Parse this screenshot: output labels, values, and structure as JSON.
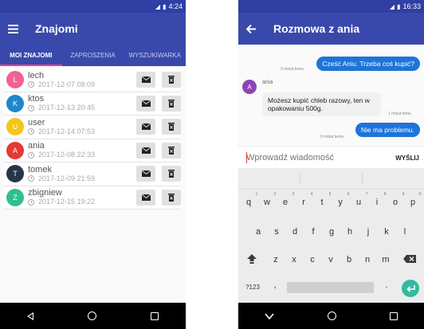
{
  "left": {
    "status": {
      "time": "4:24"
    },
    "appbar": {
      "title": "Znajomi"
    },
    "tabs": [
      {
        "label": "MOI ZNAJOMI",
        "active": true
      },
      {
        "label": "ZAPROSZENIA",
        "active": false
      },
      {
        "label": "WYSZUKIWARKA",
        "active": false
      }
    ],
    "friends": [
      {
        "initial": "L",
        "name": "lech",
        "date": "2017-12-07 08:09",
        "color": "#f06292"
      },
      {
        "initial": "K",
        "name": "ktos",
        "date": "2017-12-13 20:45",
        "color": "#1e88c8"
      },
      {
        "initial": "U",
        "name": "user",
        "date": "2017-12-14 07:53",
        "color": "#f5c518"
      },
      {
        "initial": "A",
        "name": "ania",
        "date": "2017-12-08 22:33",
        "color": "#e53935"
      },
      {
        "initial": "T",
        "name": "tomek",
        "date": "2017-12-09 21:59",
        "color": "#263548"
      },
      {
        "initial": "Z",
        "name": "zbigniew",
        "date": "2017-12-15 19:22",
        "color": "#2fbf8f"
      }
    ]
  },
  "right": {
    "status": {
      "time": "16:33"
    },
    "appbar": {
      "title": "Rozmowa z ania"
    },
    "messages": {
      "out1": {
        "text": "Cześć Aniu. Trzeba coś kupić?",
        "time": "3 minut temu"
      },
      "in1": {
        "sender_initial": "A",
        "sender_name": "ania",
        "text": "Możesz kupić chleb razowy, ten w opakowaniu 500g.",
        "time": "1 minut temu"
      },
      "out2": {
        "text": "Nie ma problemu.",
        "time": "0 minut temu"
      }
    },
    "composer": {
      "placeholder": "Wprowadź wiadomość",
      "send_label": "WYŚLIJ"
    },
    "keyboard": {
      "row1": [
        "q",
        "w",
        "e",
        "r",
        "t",
        "y",
        "u",
        "i",
        "o",
        "p"
      ],
      "row1_hints": [
        "1",
        "2",
        "3",
        "4",
        "5",
        "6",
        "7",
        "8",
        "9",
        "0"
      ],
      "row2": [
        "a",
        "s",
        "d",
        "f",
        "g",
        "h",
        "j",
        "k",
        "l"
      ],
      "row3": [
        "z",
        "x",
        "c",
        "v",
        "b",
        "n",
        "m"
      ],
      "symbols_key": "?123",
      "comma": ",",
      "period": "."
    }
  },
  "colors": {
    "primary": "#3949ab",
    "primary_dark": "#2f3fa3",
    "accent": "#ff4081",
    "bubble": "#1e74d8"
  }
}
